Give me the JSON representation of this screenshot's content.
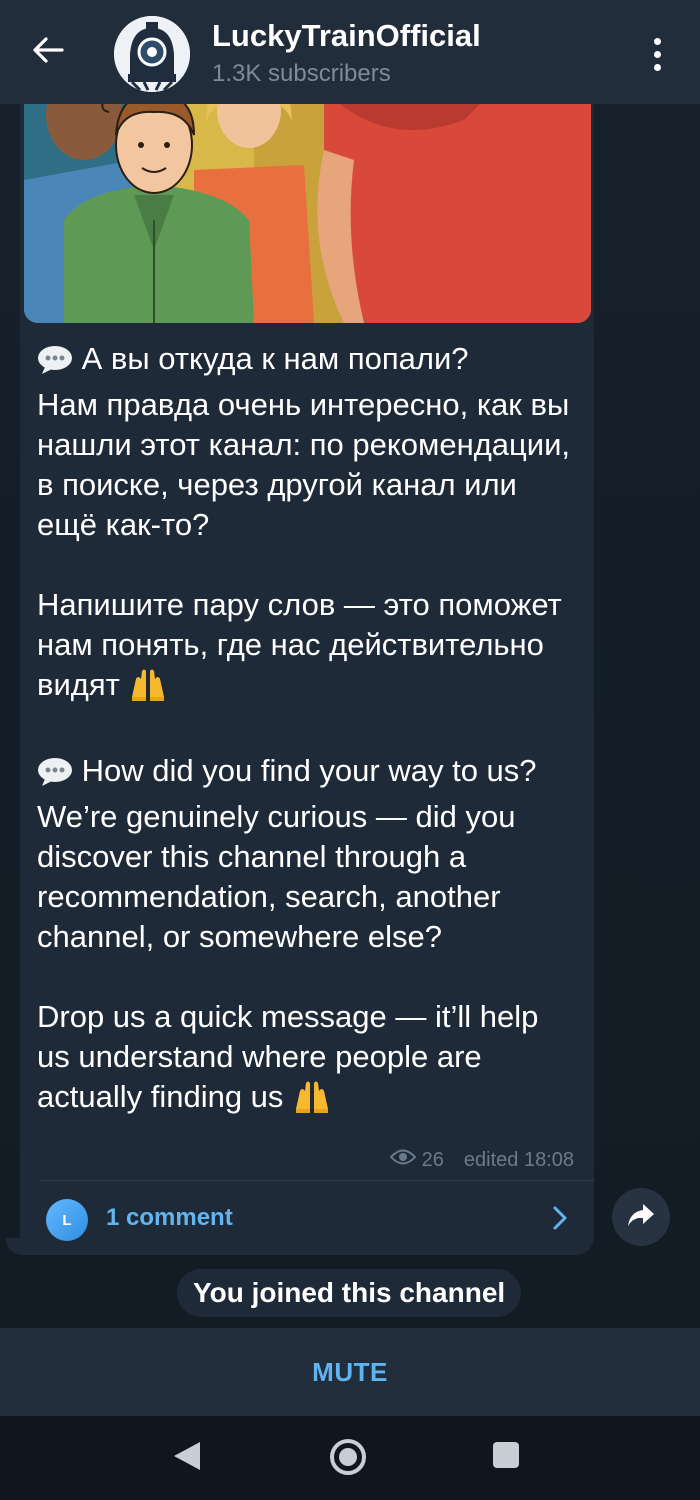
{
  "header": {
    "title": "LuckyTrainOfficial",
    "subtitle": "1.3K subscribers"
  },
  "message": {
    "ru_question": "А вы откуда к нам попали?",
    "ru_body": "Нам правда очень интересно, как вы нашли этот канал: по рекомендации, в поиске, через другой канал или ещё как-то?",
    "ru_cta": "Напишите пару слов — это поможет нам понять, где нас действительно видят",
    "en_question": "How did you find your way to us?",
    "en_body": "We’re genuinely curious — did you discover this channel through a recommendation, search, another channel, or somewhere else?",
    "en_cta": "Drop us a quick message — it’ll help us understand where people are actually finding us",
    "views": "26",
    "edited_time": "edited 18:08"
  },
  "comments": {
    "avatar_letter": "L",
    "label": "1 comment"
  },
  "service_message": "You joined this channel",
  "bottom_bar": {
    "mute_label": "MUTE"
  },
  "colors": {
    "header_bg": "#212d3b",
    "bubble_bg": "#1f2a38",
    "accent_blue": "#5eb4f2",
    "muted_text": "#7d8b99"
  },
  "icons": [
    "back-arrow-icon",
    "more-vertical-icon",
    "speech-bubble-icon",
    "raised-hands-icon",
    "eye-icon",
    "chevron-right-icon",
    "share-icon",
    "nav-back-icon",
    "nav-home-icon",
    "nav-recent-icon"
  ]
}
